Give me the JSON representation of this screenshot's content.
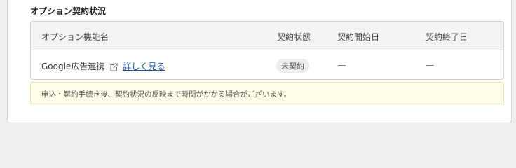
{
  "section": {
    "title": "オプション契約状況"
  },
  "table": {
    "headers": {
      "name": "オプション機能名",
      "status": "契約状態",
      "start": "契約開始日",
      "end": "契約終了日"
    },
    "rows": [
      {
        "name": "Google広告連携",
        "icon": "external-link-icon",
        "link": "詳しく見る",
        "status": "未契約",
        "start": "ー",
        "end": "ー"
      }
    ]
  },
  "notice": {
    "text": "申込・解約手続き後、契約状況の反映まで時間がかかる場合がございます。"
  },
  "colors": {
    "header_bg": "#f3f3f3",
    "notice_bg": "#fdfde8",
    "link": "#1b4f96"
  }
}
